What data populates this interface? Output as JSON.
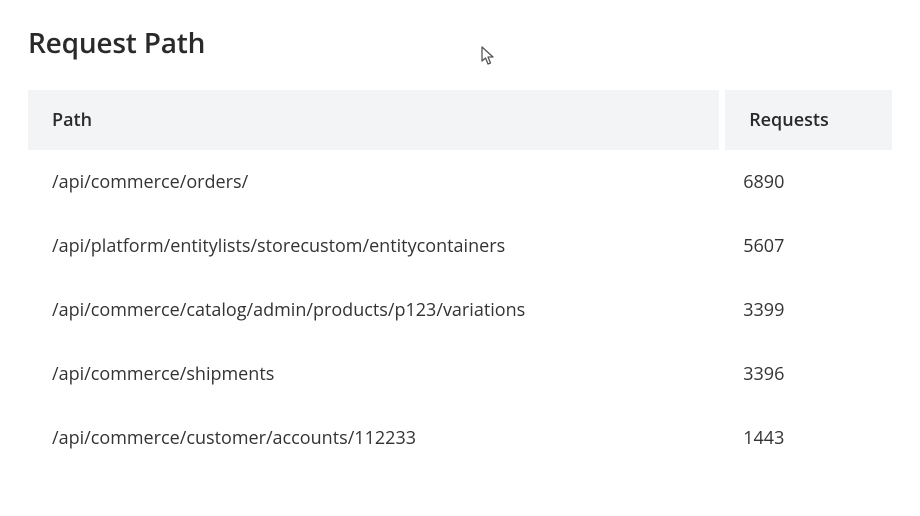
{
  "title": "Request Path",
  "table": {
    "headers": {
      "path": "Path",
      "requests": "Requests"
    },
    "rows": [
      {
        "path": "/api/commerce/orders/",
        "requests": "6890"
      },
      {
        "path": "/api/platform/entitylists/storecustom/entitycontainers",
        "requests": "5607"
      },
      {
        "path": "/api/commerce/catalog/admin/products/p123/variations",
        "requests": "3399"
      },
      {
        "path": "/api/commerce/shipments",
        "requests": "3396"
      },
      {
        "path": "/api/commerce/customer/accounts/112233",
        "requests": "1443"
      }
    ]
  }
}
